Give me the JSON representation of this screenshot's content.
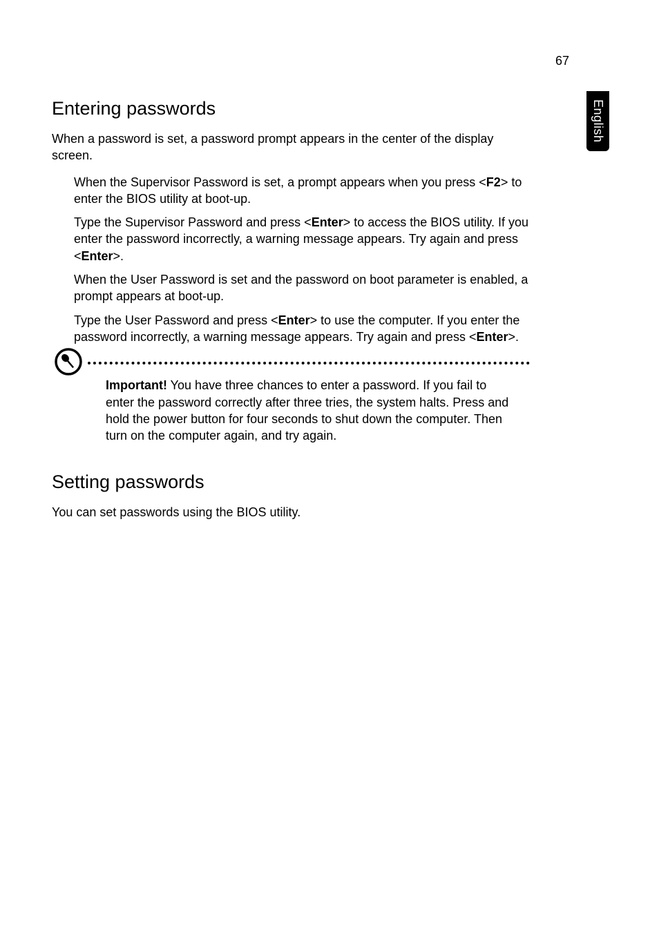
{
  "pageNumber": "67",
  "sideTab": "English",
  "section1": {
    "heading": "Entering passwords",
    "intro": "When a password is set, a password prompt appears in the center of the display screen.",
    "items": {
      "p1": "When the Supervisor Password is set, a prompt appears when you press <",
      "p1_key": "F2",
      "p1_end": "> to enter the BIOS utility at boot-up.",
      "p2": "Type the Supervisor Password and press <",
      "p2_key": "Enter",
      "p2_mid": "> to access the BIOS utility. If you enter the password incorrectly, a warning message appears. Try again and press <",
      "p2_key2": "Enter",
      "p2_end": ">.",
      "p3": "When the User Password is set and the password on boot parameter is enabled, a prompt appears at boot-up.",
      "p4": "Type the User Password and press <",
      "p4_key": "Enter",
      "p4_mid": "> to use the computer. If you enter the password incorrectly, a warning message appears. Try again and press <",
      "p4_key2": "Enter",
      "p4_end": ">."
    },
    "note": {
      "label": "Important!",
      "text": " You have three chances to enter a password. If you fail to enter the password correctly after three tries, the system halts. Press and hold the power button for four seconds to shut down the computer. Then turn on the computer again, and try again."
    }
  },
  "section2": {
    "heading": "Setting passwords",
    "intro": "You can set passwords using the BIOS utility."
  }
}
